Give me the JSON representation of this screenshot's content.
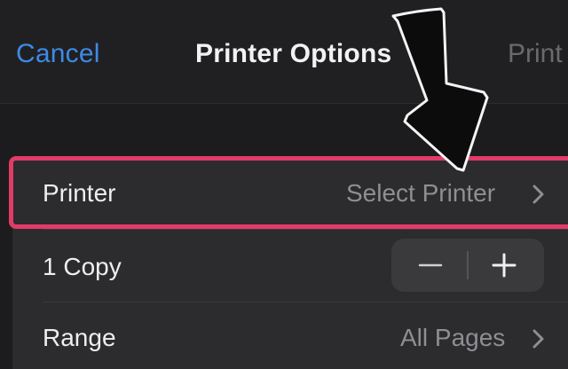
{
  "navbar": {
    "cancel_label": "Cancel",
    "title": "Printer Options",
    "print_label": "Print"
  },
  "options": {
    "printer": {
      "label": "Printer",
      "value": "Select Printer",
      "icon": "chevron-right-icon"
    },
    "copies": {
      "label": "1 Copy",
      "decrement_icon": "minus-icon",
      "increment_icon": "plus-icon"
    },
    "range": {
      "label": "Range",
      "value": "All Pages",
      "icon": "chevron-right-icon"
    }
  },
  "annotation": {
    "highlight_color": "#e23b68",
    "arrow_icon": "down-arrow-annotation-icon"
  },
  "colors": {
    "accent": "#3d8ae6",
    "background": "#1c1c1e",
    "group": "#2c2c2e"
  }
}
